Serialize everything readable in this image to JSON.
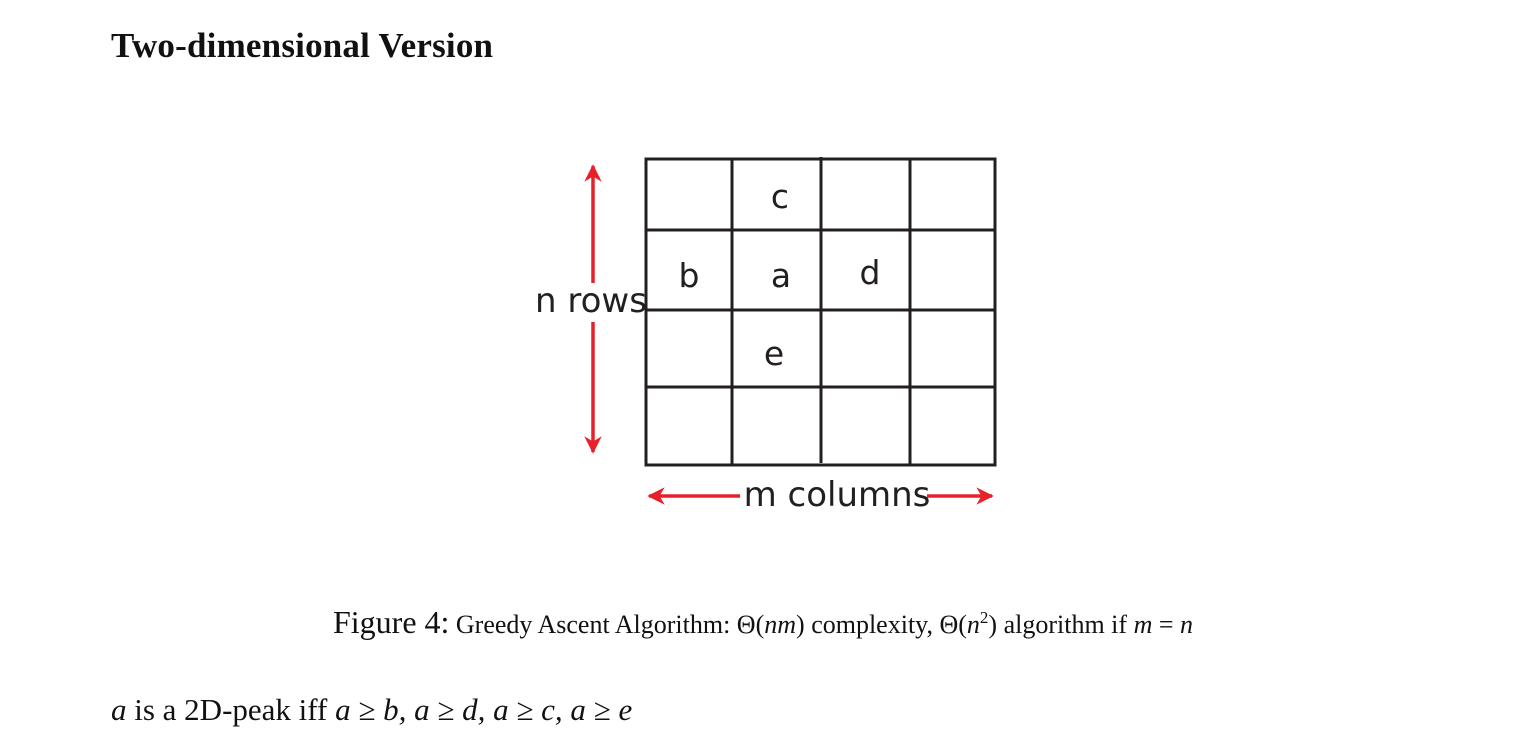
{
  "heading": "Two-dimensional Version",
  "figure": {
    "rows_label": "n rows",
    "columns_label": "m columns",
    "cells": {
      "c": "c",
      "b": "b",
      "a": "a",
      "d": "d",
      "e": "e"
    },
    "arrow_color": "#e8202a",
    "grid_color": "#231f20"
  },
  "caption": {
    "label": "Figure 4:",
    "text_1": "Greedy Ascent Algorithm: Θ(",
    "var_nm": "nm",
    "text_2": ") complexity, Θ(",
    "var_n": "n",
    "exp": "2",
    "text_3": ") algorithm if ",
    "var_m": "m",
    "eq": " = ",
    "var_n2": "n"
  },
  "statement": {
    "var_a": "a",
    "text": " is a 2D-peak iff ",
    "condition": "a ≥ b, a ≥ d, a ≥ c, a ≥ e"
  }
}
